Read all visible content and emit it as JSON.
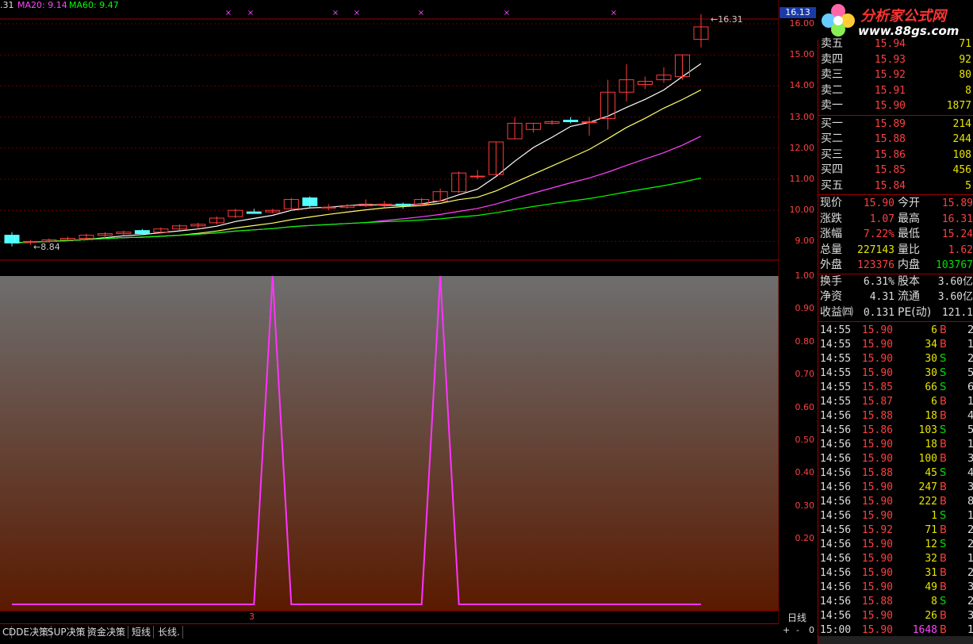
{
  "header": {
    "left_value": ".31",
    "ma20_label": "MA20: 9.14",
    "ma60_label": "MA60: 9.47",
    "price_tag": "16.13",
    "high_marker": "16.31",
    "low_marker": "8.84"
  },
  "logo": {
    "name": "分析家公式网",
    "url": "www.88gs.com"
  },
  "price_axis": [
    "16.00",
    "15.00",
    "14.00",
    "13.00",
    "12.00",
    "11.00",
    "10.00",
    "9.00"
  ],
  "indicator_axis": [
    "1.00",
    "0.90",
    "0.80",
    "0.70",
    "0.60",
    "0.50",
    "0.40",
    "0.30",
    "0.20"
  ],
  "period_label": "日线",
  "bottom_marker": "3",
  "zoom_controls": [
    "+",
    "-",
    "0"
  ],
  "bottom_tabs": [
    "DDE决策",
    "SUP决策",
    "资金决策",
    "短线",
    "长线."
  ],
  "order_book": {
    "sell": [
      {
        "label": "卖五",
        "price": "15.94",
        "vol": "71"
      },
      {
        "label": "卖四",
        "price": "15.93",
        "vol": "92"
      },
      {
        "label": "卖三",
        "price": "15.92",
        "vol": "80"
      },
      {
        "label": "卖二",
        "price": "15.91",
        "vol": "8"
      },
      {
        "label": "卖一",
        "price": "15.90",
        "vol": "1877"
      }
    ],
    "buy": [
      {
        "label": "买一",
        "price": "15.89",
        "vol": "214"
      },
      {
        "label": "买二",
        "price": "15.88",
        "vol": "244"
      },
      {
        "label": "买三",
        "price": "15.86",
        "vol": "108"
      },
      {
        "label": "买四",
        "price": "15.85",
        "vol": "456"
      },
      {
        "label": "买五",
        "price": "15.84",
        "vol": "5"
      }
    ]
  },
  "stats": [
    {
      "l1": "现价",
      "v1": "15.90",
      "c1": "#ff4040",
      "l2": "今开",
      "v2": "15.89",
      "c2": "#ff4040"
    },
    {
      "l1": "涨跌",
      "v1": "1.07",
      "c1": "#ff4040",
      "l2": "最高",
      "v2": "16.31",
      "c2": "#ff4040"
    },
    {
      "l1": "涨幅",
      "v1": "7.22%",
      "c1": "#ff4040",
      "l2": "最低",
      "v2": "15.24",
      "c2": "#ff4040"
    },
    {
      "l1": "总量",
      "v1": "227143",
      "c1": "#e6e600",
      "l2": "量比",
      "v2": "1.62",
      "c2": "#ff4040"
    },
    {
      "l1": "外盘",
      "v1": "123376",
      "c1": "#ff4040",
      "l2": "内盘",
      "v2": "103767",
      "c2": "#00e000"
    },
    {
      "l1": "换手",
      "v1": "6.31%",
      "c1": "#ddd",
      "l2": "股本",
      "v2": "3.60亿",
      "c2": "#ddd"
    },
    {
      "l1": "净资",
      "v1": "4.31",
      "c1": "#ddd",
      "l2": "流通",
      "v2": "3.60亿",
      "c2": "#ddd"
    },
    {
      "l1": "收益㈣",
      "v1": "0.131",
      "c1": "#ddd",
      "l2": "PE(动)",
      "v2": "121.1",
      "c2": "#ddd"
    }
  ],
  "ticks": [
    {
      "t": "14:55",
      "p": "15.90",
      "v": "6",
      "bs": "B",
      "n": "2"
    },
    {
      "t": "14:55",
      "p": "15.90",
      "v": "34",
      "bs": "B",
      "n": "1"
    },
    {
      "t": "14:55",
      "p": "15.90",
      "v": "30",
      "bs": "S",
      "n": "2"
    },
    {
      "t": "14:55",
      "p": "15.90",
      "v": "30",
      "bs": "S",
      "n": "5"
    },
    {
      "t": "14:55",
      "p": "15.85",
      "v": "66",
      "bs": "S",
      "n": "6"
    },
    {
      "t": "14:55",
      "p": "15.87",
      "v": "6",
      "bs": "B",
      "n": "1"
    },
    {
      "t": "14:56",
      "p": "15.88",
      "v": "18",
      "bs": "B",
      "n": "4"
    },
    {
      "t": "14:56",
      "p": "15.86",
      "v": "103",
      "bs": "S",
      "n": "5"
    },
    {
      "t": "14:56",
      "p": "15.90",
      "v": "18",
      "bs": "B",
      "n": "1"
    },
    {
      "t": "14:56",
      "p": "15.90",
      "v": "100",
      "bs": "B",
      "n": "3"
    },
    {
      "t": "14:56",
      "p": "15.88",
      "v": "45",
      "bs": "S",
      "n": "4"
    },
    {
      "t": "14:56",
      "p": "15.90",
      "v": "247",
      "bs": "B",
      "n": "3"
    },
    {
      "t": "14:56",
      "p": "15.90",
      "v": "222",
      "bs": "B",
      "n": "8"
    },
    {
      "t": "14:56",
      "p": "15.90",
      "v": "1",
      "bs": "S",
      "n": "1"
    },
    {
      "t": "14:56",
      "p": "15.92",
      "v": "71",
      "bs": "B",
      "n": "2"
    },
    {
      "t": "14:56",
      "p": "15.90",
      "v": "12",
      "bs": "S",
      "n": "2"
    },
    {
      "t": "14:56",
      "p": "15.90",
      "v": "32",
      "bs": "B",
      "n": "1"
    },
    {
      "t": "14:56",
      "p": "15.90",
      "v": "31",
      "bs": "B",
      "n": "2"
    },
    {
      "t": "14:56",
      "p": "15.90",
      "v": "49",
      "bs": "B",
      "n": "3"
    },
    {
      "t": "14:56",
      "p": "15.88",
      "v": "8",
      "bs": "S",
      "n": "2"
    },
    {
      "t": "14:56",
      "p": "15.90",
      "v": "26",
      "bs": "B",
      "n": "3"
    },
    {
      "t": "15:00",
      "p": "15.90",
      "v": "1648",
      "bs": "B",
      "n": "128"
    }
  ],
  "colors": {
    "up": "#ff3c3c",
    "down": "#54ffff",
    "ma5": "#ffffff",
    "ma10": "#ffff66",
    "ma20": "#ff44ff",
    "ma60": "#00ff00",
    "indicator": "#ff33ff"
  },
  "chart_data": {
    "type": "candlestick",
    "ylim": [
      8.6,
      16.5
    ],
    "candles": [
      [
        9.2,
        9.3,
        8.84,
        8.95
      ],
      [
        9.0,
        9.05,
        8.9,
        9.0
      ],
      [
        9.0,
        9.1,
        8.95,
        9.05
      ],
      [
        9.05,
        9.15,
        9.0,
        9.1
      ],
      [
        9.1,
        9.25,
        9.05,
        9.2
      ],
      [
        9.2,
        9.3,
        9.1,
        9.25
      ],
      [
        9.25,
        9.35,
        9.2,
        9.3
      ],
      [
        9.35,
        9.4,
        9.2,
        9.25
      ],
      [
        9.3,
        9.45,
        9.25,
        9.4
      ],
      [
        9.4,
        9.55,
        9.35,
        9.5
      ],
      [
        9.5,
        9.6,
        9.4,
        9.55
      ],
      [
        9.6,
        9.8,
        9.55,
        9.75
      ],
      [
        9.8,
        10.05,
        9.75,
        10.0
      ],
      [
        9.95,
        10.05,
        9.9,
        9.9
      ],
      [
        9.95,
        10.05,
        9.9,
        10.0
      ],
      [
        10.05,
        10.4,
        10.0,
        10.35
      ],
      [
        10.4,
        10.45,
        10.1,
        10.15
      ],
      [
        10.1,
        10.2,
        10.0,
        10.1
      ],
      [
        10.1,
        10.2,
        10.05,
        10.15
      ],
      [
        10.15,
        10.35,
        10.1,
        10.2
      ],
      [
        10.2,
        10.3,
        10.1,
        10.2
      ],
      [
        10.2,
        10.25,
        10.05,
        10.15
      ],
      [
        10.2,
        10.4,
        10.15,
        10.35
      ],
      [
        10.3,
        10.7,
        10.3,
        10.6
      ],
      [
        10.6,
        11.25,
        10.55,
        11.2
      ],
      [
        11.1,
        11.3,
        11.0,
        11.1
      ],
      [
        11.15,
        12.2,
        11.1,
        12.2
      ],
      [
        12.3,
        13.0,
        12.3,
        12.8
      ],
      [
        12.6,
        12.8,
        12.5,
        12.8
      ],
      [
        12.8,
        12.9,
        12.75,
        12.85
      ],
      [
        12.9,
        13.0,
        12.8,
        12.85
      ],
      [
        12.85,
        13.0,
        12.4,
        12.85
      ],
      [
        12.95,
        14.2,
        12.6,
        13.8
      ],
      [
        13.8,
        14.7,
        13.5,
        14.2
      ],
      [
        14.05,
        14.3,
        13.9,
        14.15
      ],
      [
        14.2,
        14.6,
        14.1,
        14.35
      ],
      [
        14.3,
        15.0,
        14.2,
        15.0
      ],
      [
        15.5,
        16.31,
        15.24,
        15.9
      ]
    ],
    "ma_series": [
      {
        "name": "MA20",
        "value": 9.14
      },
      {
        "name": "MA60",
        "value": 9.47
      }
    ],
    "indicator": {
      "ylim": [
        0,
        1.0
      ],
      "spike_positions": [
        14,
        23
      ],
      "values_note": "pulses reach 1.00 at two points, otherwise 0"
    }
  }
}
